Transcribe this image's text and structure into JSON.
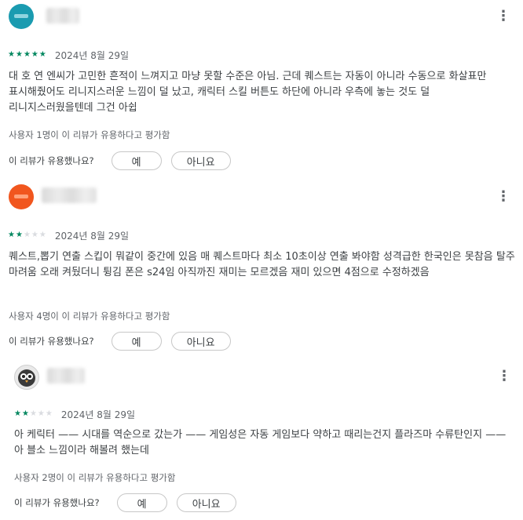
{
  "reviews": [
    {
      "avatar": "teal-avatar",
      "rating": 5,
      "stars": [
        "★",
        "★",
        "★",
        "★",
        "★"
      ],
      "date": "2024년 8월 29일",
      "text": "대 호 연 엔씨가 고민한 흔적이 느껴지고 마냥 못할 수준은 아님. 근데 퀘스트는 자동이 아니라 수동으로 화살표만 표시해줬어도 리니지스러운 느낌이 덜 났고, 캐릭터 스킬 버튼도 하단에 아니라 우측에 놓는 것도 덜 리니지스러웠을텐데 그건 아쉽",
      "helpful_count": "사용자 1명이 이 리뷰가 유용하다고 평가함",
      "helpful_question": "이 리뷰가 유용했나요?",
      "yes_label": "예",
      "no_label": "아니요"
    },
    {
      "avatar": "orange-avatar",
      "rating": 2,
      "stars": [
        "★",
        "★",
        "★",
        "★",
        "★"
      ],
      "date": "2024년 8월 29일",
      "text": "퀘스트,뽑기 연출 스킵이 뭐같이 중간에 있음 매 퀘스트마다 최소 10초이상 연출 봐야함 성격급한 한국인은 못참음 탈주 마려움 오래 켜뒀더니 튕김 폰은 s24임 아직까진 재미는 모르겠음 재미 있으면 4점으로 수정하겠음",
      "helpful_count": "사용자 4명이 이 리뷰가 유용하다고 평가함",
      "helpful_question": "이 리뷰가 유용했나요?",
      "yes_label": "예",
      "no_label": "아니요"
    },
    {
      "avatar": "owl-avatar",
      "rating": 2,
      "stars": [
        "★",
        "★",
        "★",
        "★",
        "★"
      ],
      "date": "2024년 8월 29일",
      "text": "아 케릭터 —— 시대를 역순으로 갔는가 —— 게임성은 자동 게임보다 약하고 때리는건지 플라즈마 수류탄인지 —— 아 블소 느낌이라 해볼려 했는데",
      "helpful_count": "사용자 2명이 이 리뷰가 유용하다고 평가함",
      "helpful_question": "이 리뷰가 유용했나요?",
      "yes_label": "예",
      "no_label": "아니요"
    }
  ],
  "icons": {
    "more": "⋮",
    "more_name": "more-vert-icon"
  },
  "colors": {
    "star_filled": "#01875f",
    "star_empty": "#dadce0"
  }
}
